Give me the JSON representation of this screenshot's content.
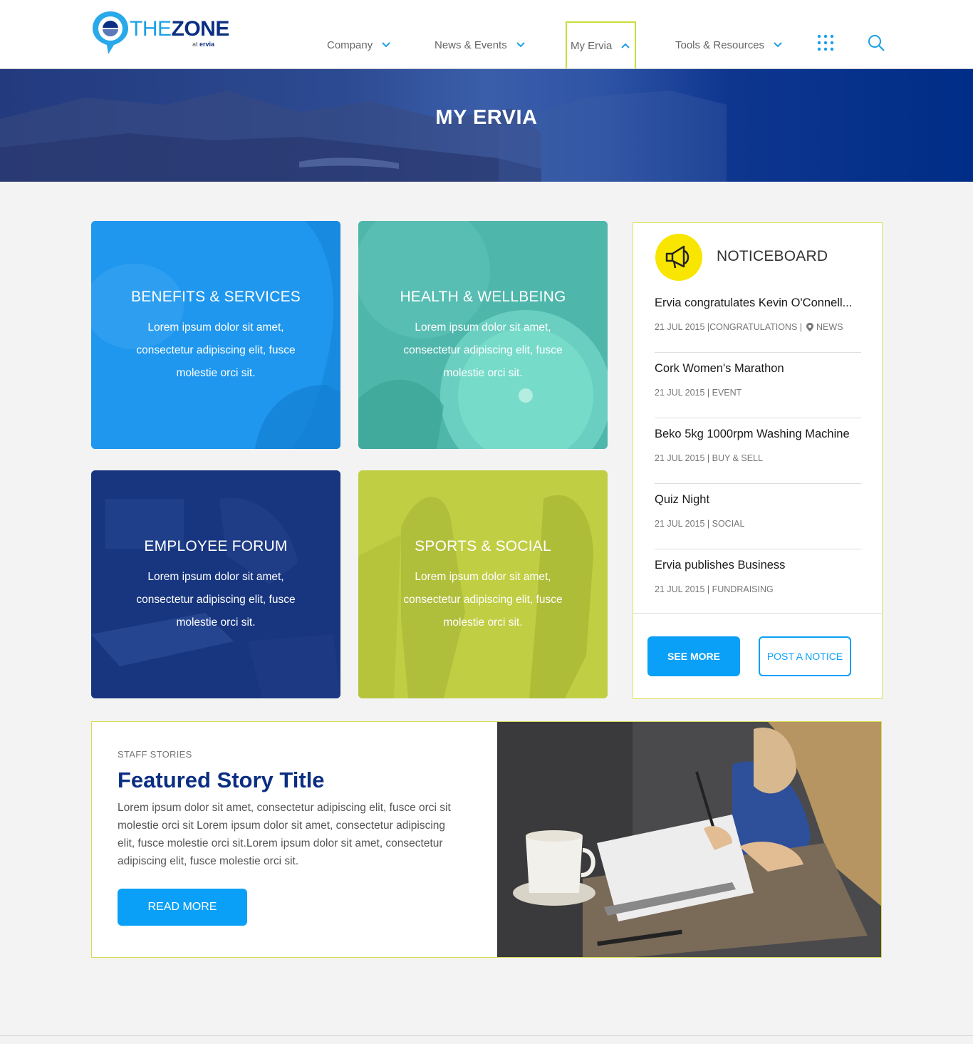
{
  "brand": {
    "name_part1": "THE",
    "name_part2": "ZONE",
    "sub_prefix": "at",
    "sub_brand": "ervia"
  },
  "nav": {
    "items": [
      {
        "label": "Company"
      },
      {
        "label": "News & Events"
      },
      {
        "label": "My Ervia",
        "active": true
      },
      {
        "label": "Tools & Resources"
      }
    ]
  },
  "hero": {
    "title": "MY ERVIA"
  },
  "tiles": [
    {
      "title": "BENEFITS & SERVICES",
      "text": "Lorem ipsum dolor sit amet, consectetur adipiscing elit, fusce molestie orci sit.",
      "color": "#1f97ee"
    },
    {
      "title": "HEALTH & WELLBEING",
      "text": "Lorem ipsum dolor sit amet, consectetur adipiscing elit, fusce molestie orci sit.",
      "color": "#45b3ad"
    },
    {
      "title": "EMPLOYEE FORUM",
      "text": "Lorem ipsum dolor sit amet, consectetur adipiscing elit, fusce molestie orci sit.",
      "color": "#17357f"
    },
    {
      "title": "SPORTS & SOCIAL",
      "text": "Lorem ipsum dolor sit amet, consectetur adipiscing elit, fusce molestie orci sit.",
      "color": "#bfcd3f"
    }
  ],
  "noticeboard": {
    "heading": "NOTICEBOARD",
    "items": [
      {
        "title": "Ervia congratulates Kevin O'Connell...",
        "meta": "21 JUL 2015 |CONGRATULATIONS |",
        "extra": "NEWS"
      },
      {
        "title": "Cork Women's Marathon",
        "meta": "21 JUL 2015 | EVENT",
        "extra": ""
      },
      {
        "title": "Beko 5kg 1000rpm Washing Machine",
        "meta": "21 JUL 2015 | BUY & SELL",
        "extra": ""
      },
      {
        "title": "Quiz Night",
        "meta": "21 JUL 2015 | SOCIAL",
        "extra": ""
      },
      {
        "title": "Ervia publishes Business",
        "meta": "21 JUL 2015 | FUNDRAISING",
        "extra": ""
      }
    ],
    "see_more": "SEE MORE",
    "post_notice": "POST A NOTICE"
  },
  "story": {
    "kicker": "STAFF STORIES",
    "title": "Featured Story Title",
    "body": "Lorem ipsum dolor sit amet, consectetur adipiscing elit, fusce orci sit molestie orci sit Lorem ipsum dolor sit amet, consectetur adipiscing elit, fusce molestie orci sit.Lorem ipsum dolor sit amet, consectetur adipiscing elit, fusce molestie orci sit.",
    "button": "READ MORE"
  },
  "colors": {
    "accent": "#0aa0f7",
    "brand_navy": "#0b2e82",
    "highlight": "#c9dd3a",
    "notice_icon": "#f8e600"
  }
}
